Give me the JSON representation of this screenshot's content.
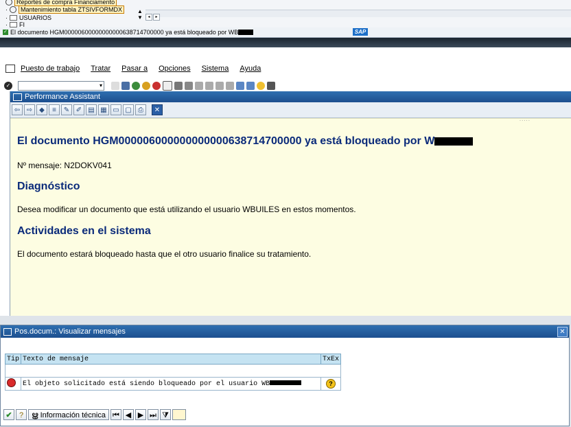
{
  "top_fragment": {
    "tree_items": [
      "Reportes de compra Financiamento",
      "Mantenimiento tabla ZTSIVFORMDX",
      "USUARIOS",
      "FI"
    ],
    "status_text": "El documento HGM00000600000000000638714700000 ya está bloqueado por WB",
    "sap_logo": "SAP"
  },
  "menu": {
    "items": [
      "Puesto de trabajo",
      "Tratar",
      "Pasar a",
      "Opciones",
      "Sistema",
      "Ayuda"
    ]
  },
  "performance_assistant": {
    "title": "Performance Assistant",
    "heading": "El documento HGM000006000000000000638714700000 ya está bloqueado por W",
    "message_number": "Nº mensaje: N2DOKV041",
    "diagnostic_title": "Diagnóstico",
    "diagnostic_text": "Desea modificar un documento que está utilizando el usuario WBUILES en estos momentos.",
    "activities_title": "Actividades en el sistema",
    "activities_text": "El documento estará bloqueado hasta que el otro usuario finalice su tratamiento.",
    "splitter": "....."
  },
  "messages_dialog": {
    "title": "Pos.docum.: Visualizar mensajes",
    "columns": [
      "Tip",
      "Texto de mensaje",
      "TxEx"
    ],
    "rows": [
      {
        "type": "error",
        "text": "El objeto solicitado está siendo bloqueado por el usuario WB"
      }
    ],
    "technical_info_label": "Información técnica"
  },
  "colors": {
    "titlebar": "#1d4f8f",
    "heading": "#0a2a7a",
    "content_bg": "#fdfde2",
    "table_header": "#c5e3f2"
  }
}
